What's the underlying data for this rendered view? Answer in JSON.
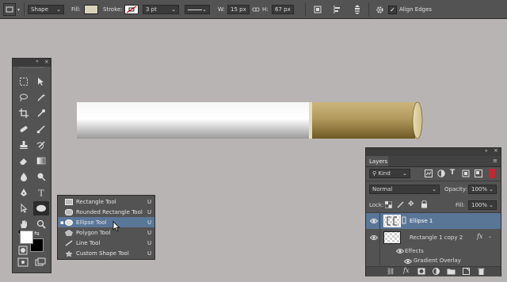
{
  "options_bar": {
    "mode": "Shape",
    "fill_label": "Fill:",
    "stroke_label": "Stroke:",
    "stroke_width": "3 pt",
    "w_label": "W:",
    "w_value": "15 px",
    "h_label": "H:",
    "h_value": "67 px",
    "align_edges_label": "Align Edges",
    "fill_color": "#d8d4bc",
    "align_edges_checked": true
  },
  "flyout": {
    "items": [
      {
        "label": "Rectangle Tool",
        "key": "U",
        "icon": "rectangle-tool-icon",
        "selected": false
      },
      {
        "label": "Rounded Rectangle Tool",
        "key": "U",
        "icon": "rounded-rectangle-tool-icon",
        "selected": false
      },
      {
        "label": "Ellipse Tool",
        "key": "U",
        "icon": "ellipse-tool-icon",
        "selected": true
      },
      {
        "label": "Polygon Tool",
        "key": "U",
        "icon": "polygon-tool-icon",
        "selected": false
      },
      {
        "label": "Line Tool",
        "key": "U",
        "icon": "line-tool-icon",
        "selected": false
      },
      {
        "label": "Custom Shape Tool",
        "key": "U",
        "icon": "custom-shape-tool-icon",
        "selected": false
      }
    ]
  },
  "layers_panel": {
    "tab": "Layers",
    "filter_kind": "Kind",
    "blend_mode": "Normal",
    "opacity_label": "Opacity:",
    "opacity_value": "100%",
    "lock_label": "Lock:",
    "fill_label": "Fill:",
    "fill_value": "100%",
    "layers": [
      {
        "name": "Ellipse 1",
        "selected": true
      },
      {
        "name": "Rectangle 1 copy 2",
        "selected": false,
        "fx": "fx"
      }
    ],
    "effects_label": "Effects",
    "effect_item": "Gradient Overlay"
  },
  "colors": {
    "foreground": "#ffffff",
    "background": "#000000",
    "canvas": "#b9b4b4",
    "selection": "#5a7697"
  }
}
